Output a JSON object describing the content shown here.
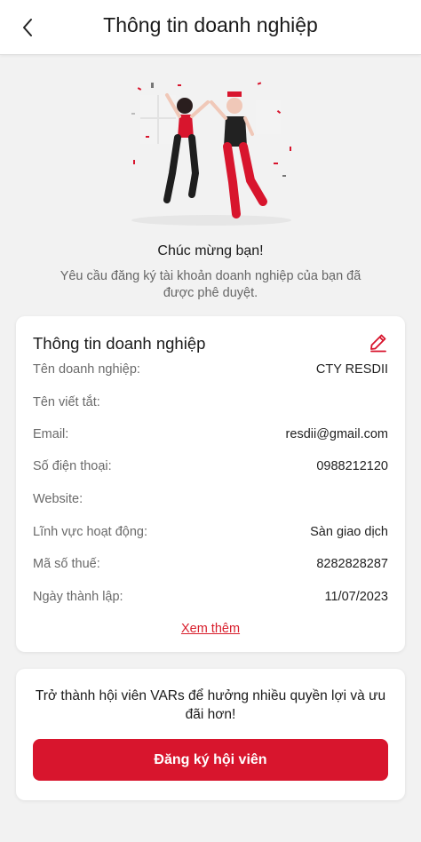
{
  "header": {
    "title": "Thông tin doanh nghiệp",
    "back_icon": "chevron-left-icon"
  },
  "success": {
    "title": "Chúc mừng bạn!",
    "message": "Yêu cầu đăng ký tài khoản doanh nghiệp của bạn đã được phê duyệt."
  },
  "business_info": {
    "title": "Thông tin doanh nghiệp",
    "edit_icon": "pencil-icon",
    "fields": [
      {
        "label": "Tên doanh nghiệp:",
        "value": "CTY RESDII"
      },
      {
        "label": "Tên viết tắt:",
        "value": ""
      },
      {
        "label": "Email:",
        "value": "resdii@gmail.com"
      },
      {
        "label": "Số điện thoại:",
        "value": "0988212120"
      },
      {
        "label": "Website:",
        "value": ""
      },
      {
        "label": "Lĩnh vực hoạt động:",
        "value": "Sàn giao dịch"
      },
      {
        "label": "Mã số thuế:",
        "value": "8282828287"
      },
      {
        "label": "Ngày thành lập:",
        "value": "11/07/2023"
      }
    ],
    "more_link": "Xem thêm"
  },
  "membership": {
    "message": "Trở thành hội viên VARs để hưởng nhiều quyền lợi và ưu đãi hơn!",
    "button_label": "Đăng ký hội viên"
  },
  "colors": {
    "accent": "#d8152d",
    "background": "#f2f2f2"
  }
}
